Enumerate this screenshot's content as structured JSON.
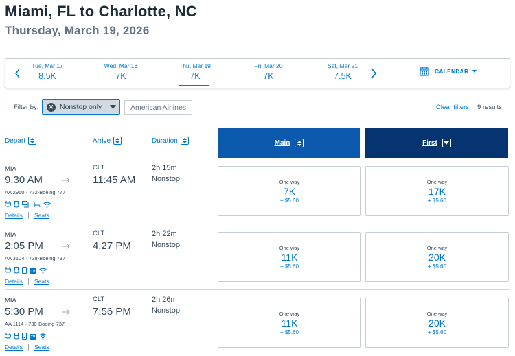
{
  "header": {
    "title": "Miami, FL to Charlotte, NC",
    "date": "Thursday, March 19, 2026"
  },
  "datebar": {
    "dates": [
      {
        "label": "Tue, Mar 17",
        "value": "8.5K",
        "active": false
      },
      {
        "label": "Wed, Mar 18",
        "value": "7K",
        "active": false
      },
      {
        "label": "Thu, Mar 19",
        "value": "7K",
        "active": true
      },
      {
        "label": "Fri, Mar 20",
        "value": "7K",
        "active": false
      },
      {
        "label": "Sat, Mar 21",
        "value": "7.5K",
        "active": false
      }
    ],
    "calendar_label": "CALENDAR"
  },
  "filters": {
    "label": "Filter by:",
    "selected": "Nonstop only",
    "airline": "American Airlines",
    "clear": "Clear filters",
    "results": "9 results"
  },
  "columns": {
    "depart": "Depart",
    "arrive": "Arrive",
    "duration": "Duration",
    "main": "Main",
    "first": "First"
  },
  "flights": [
    {
      "depart_code": "MIA",
      "depart_time": "9:30 AM",
      "arrive_code": "CLT",
      "arrive_time": "11:45 AM",
      "duration": "2h 15m",
      "stops": "Nonstop",
      "flight_info": "AA 2960  ◦  772-Boeing 777",
      "amenities": [
        "power-icon",
        "usb-icon",
        "seatback-entertainment-icon",
        "lie-flat-seat-icon",
        "wifi-icon"
      ],
      "details": "Details",
      "seats": "Seats",
      "main": {
        "label": "One way",
        "points": "7K",
        "tax": "+ $5.60"
      },
      "first": {
        "label": "One way",
        "points": "17K",
        "tax": "+ $5.60"
      }
    },
    {
      "depart_code": "MIA",
      "depart_time": "2:05 PM",
      "arrive_code": "CLT",
      "arrive_time": "4:27 PM",
      "duration": "2h 22m",
      "stops": "Nonstop",
      "flight_info": "AA 3104  ◦  738-Boeing 737",
      "amenities": [
        "power-icon",
        "usb-icon",
        "device-entertainment-icon",
        "tv-icon",
        "wifi-icon"
      ],
      "details": "Details",
      "seats": "Seats",
      "main": {
        "label": "One way",
        "points": "11K",
        "tax": "+ $5.60"
      },
      "first": {
        "label": "One way",
        "points": "20K",
        "tax": "+ $5.60"
      }
    },
    {
      "depart_code": "MIA",
      "depart_time": "5:30 PM",
      "arrive_code": "CLT",
      "arrive_time": "7:56 PM",
      "duration": "2h 26m",
      "stops": "Nonstop",
      "flight_info": "AA 1114  ◦  738-Boeing 737",
      "amenities": [
        "power-icon",
        "usb-icon",
        "device-entertainment-icon",
        "tv-icon",
        "wifi-icon"
      ],
      "details": "Details",
      "seats": "Seats",
      "main": {
        "label": "One way",
        "points": "11K",
        "tax": "+ $5.60"
      },
      "first": {
        "label": "One way",
        "points": "20K",
        "tax": "+ $5.60"
      }
    }
  ],
  "colors": {
    "accent": "#0078d2",
    "main_header": "#0b5aad",
    "first_header": "#053470"
  }
}
